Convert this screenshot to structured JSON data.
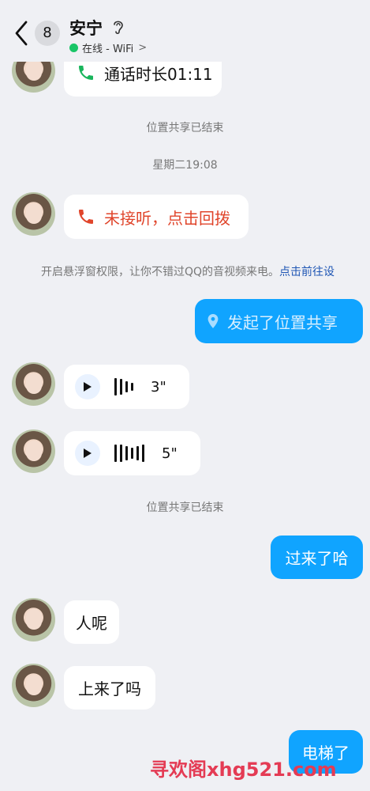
{
  "header": {
    "unread_count": "8",
    "contact_name": "安宁",
    "status_text": "在线 - WiFi",
    "chevron": ">"
  },
  "messages": {
    "call_duration": "通话时长01:11",
    "system_location_ended_1": "位置共享已结束",
    "timestamp": "星期二19:08",
    "missed_call": "未接听，点击回拨",
    "permission_notice": "开启悬浮窗权限，让你不错过QQ的音视频来电。",
    "permission_link": "点击前往设",
    "location_share_started": "发起了位置共享",
    "voice_1_duration": "3\"",
    "voice_2_duration": "5\"",
    "system_location_ended_2": "位置共享已结束",
    "sent_come_over": "过来了哈",
    "recv_where": "人呢",
    "recv_coming_up": "上来了吗",
    "sent_elevator": "电梯了"
  },
  "watermark": "寻欢阁xhg521.com",
  "colors": {
    "background": "#eff0f4",
    "sent_bubble": "#10a4ff",
    "online_dot": "#19c567",
    "call_green": "#19b55c",
    "missed_red": "#e0452b",
    "link_blue": "#1f56b4",
    "watermark_red": "#e43b54"
  }
}
